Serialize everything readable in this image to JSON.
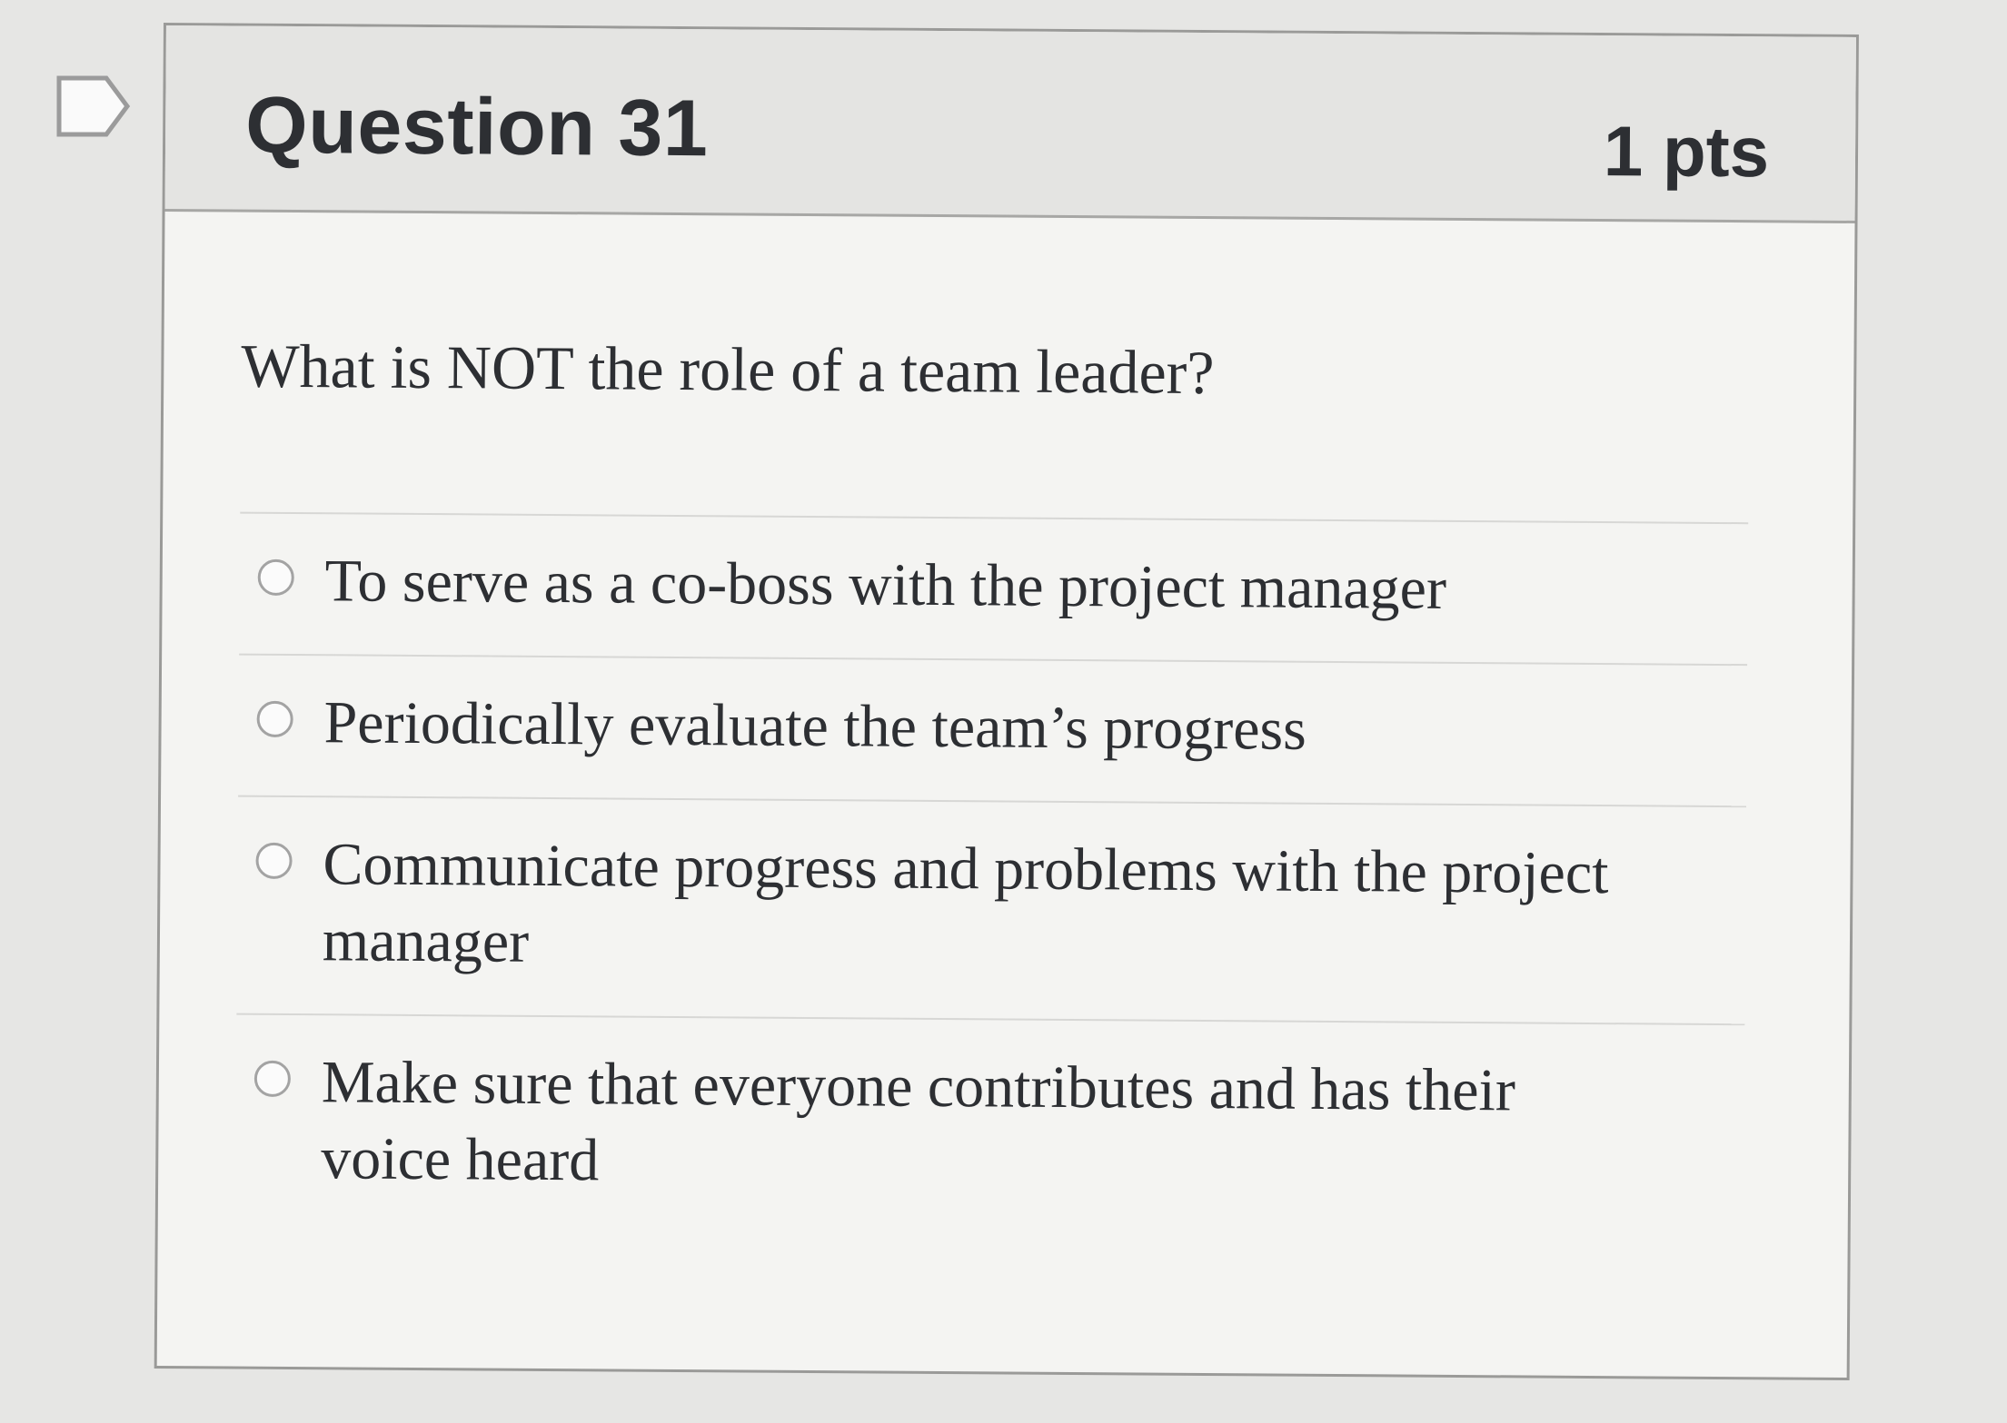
{
  "question": {
    "title": "Question 31",
    "points": "1 pts",
    "prompt": "What is NOT the role of a team leader?",
    "flag_icon": "flag-icon",
    "answers": [
      {
        "label": "To serve as a co-boss with the project manager"
      },
      {
        "label": "Periodically evaluate the team’s progress"
      },
      {
        "label": "Communicate progress and problems with the project manager"
      },
      {
        "label": "Make sure that everyone contributes and has their voice heard"
      }
    ]
  }
}
